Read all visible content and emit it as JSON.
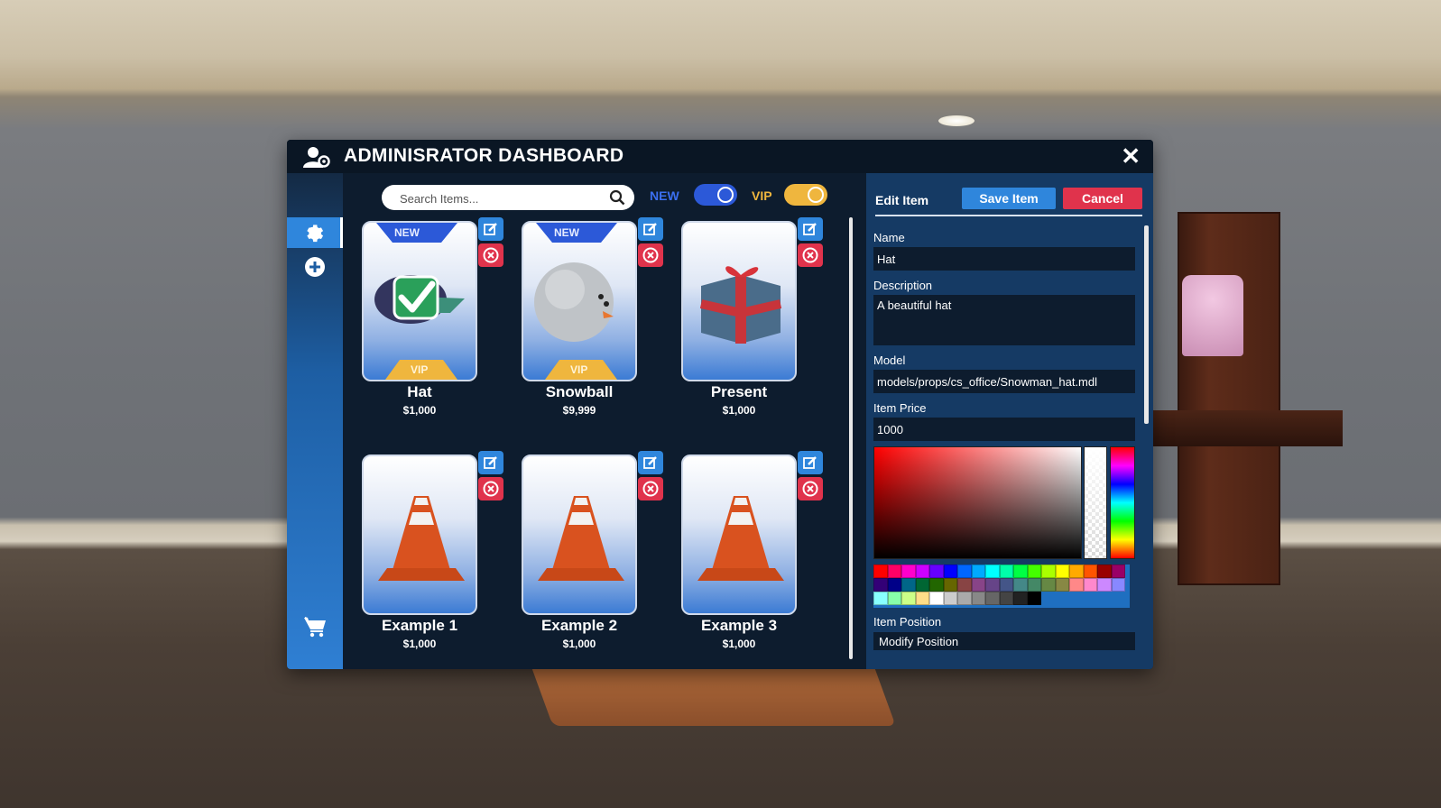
{
  "window": {
    "title": "ADMINISRATOR DASHBOARD"
  },
  "search": {
    "placeholder": "Search Items..."
  },
  "filters": {
    "new_label": "NEW",
    "vip_label": "VIP",
    "new_color": "#2c59d8",
    "vip_color": "#efb63e"
  },
  "sidebar": {
    "items": [
      {
        "icon": "gear-icon",
        "active": true
      },
      {
        "icon": "plus-circle-icon",
        "active": false
      },
      {
        "icon": "cart-icon",
        "active": false
      }
    ]
  },
  "items": [
    {
      "name": "Hat",
      "price": "$1,000",
      "new_badge": "NEW",
      "vip_badge": "VIP",
      "image": "hat-with-checkmark"
    },
    {
      "name": "Snowball",
      "price": "$9,999",
      "new_badge": "NEW",
      "vip_badge": "VIP",
      "image": "snowball-face"
    },
    {
      "name": "Present",
      "price": "$1,000",
      "image": "gift-box"
    },
    {
      "name": "Example 1",
      "price": "$1,000",
      "image": "traffic-cone"
    },
    {
      "name": "Example 2",
      "price": "$1,000",
      "image": "traffic-cone"
    },
    {
      "name": "Example 3",
      "price": "$1,000",
      "image": "traffic-cone"
    }
  ],
  "edit": {
    "title": "Edit Item",
    "save_label": "Save Item",
    "cancel_label": "Cancel",
    "name_label": "Name",
    "name_value": "Hat",
    "description_label": "Description",
    "description_value": "A beautiful hat",
    "model_label": "Model",
    "model_value": "models/props/cs_office/Snowman_hat.mdl",
    "price_label": "Item Price",
    "price_value": "1000",
    "position_label": "Item Position",
    "position_button": "Modify Position"
  },
  "colors": {
    "accent": "#2f86dc",
    "danger": "#e0334c",
    "panel_bg": "#0d1c2e",
    "edit_bg": "#153a64"
  }
}
